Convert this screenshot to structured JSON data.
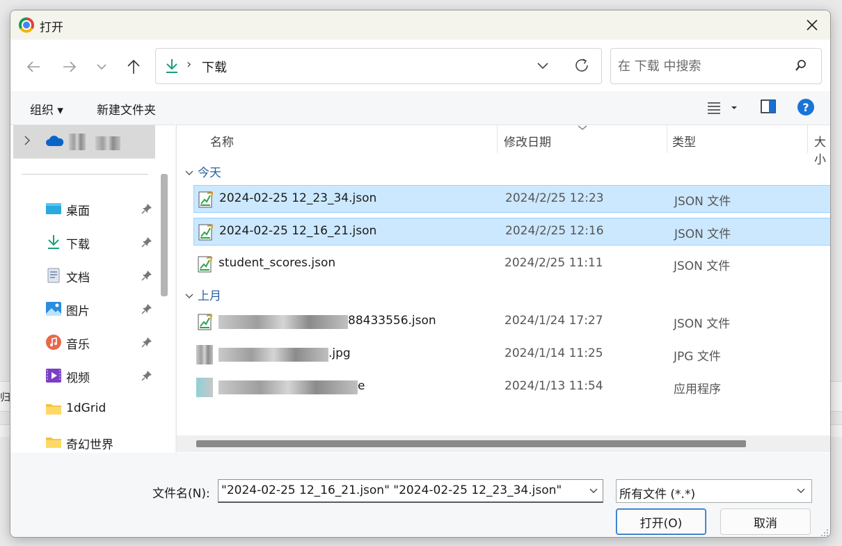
{
  "background": {
    "edge_text": "归存"
  },
  "dialog": {
    "title": "打开",
    "nav": {
      "path_separator": "›",
      "path": "下载"
    },
    "search": {
      "placeholder": "在 下载 中搜索",
      "value": ""
    },
    "toolbar": {
      "organize": "组织 ▾",
      "new_folder": "新建文件夹"
    },
    "sidebar": {
      "items": [
        {
          "label": "桌面",
          "icon": "desktop-icon",
          "pinned": true
        },
        {
          "label": "下载",
          "icon": "download-icon",
          "pinned": true
        },
        {
          "label": "文档",
          "icon": "document-icon",
          "pinned": true
        },
        {
          "label": "图片",
          "icon": "pictures-icon",
          "pinned": true
        },
        {
          "label": "音乐",
          "icon": "music-icon",
          "pinned": true
        },
        {
          "label": "视频",
          "icon": "video-icon",
          "pinned": true
        },
        {
          "label": "1dGrid",
          "icon": "folder-icon",
          "pinned": false
        },
        {
          "label": "奇幻世界",
          "icon": "folder-icon",
          "pinned": false
        }
      ]
    },
    "columns": {
      "name": "名称",
      "modified": "修改日期",
      "type": "类型",
      "size": "大小"
    },
    "groups": [
      {
        "label": "今天",
        "files": [
          {
            "name": "2024-02-25 12_23_34.json",
            "date": "2024/2/25 12:23",
            "type": "JSON 文件",
            "selected": true
          },
          {
            "name": "2024-02-25 12_16_21.json",
            "date": "2024/2/25 12:16",
            "type": "JSON 文件",
            "selected": true
          },
          {
            "name": "student_scores.json",
            "date": "2024/2/25 11:11",
            "type": "JSON 文件",
            "selected": false
          }
        ]
      },
      {
        "label": "上月",
        "files": [
          {
            "name": "88433556.json",
            "date": "2024/1/24 17:27",
            "type": "JSON 文件",
            "selected": false
          },
          {
            "name": ".jpg",
            "date": "2024/1/14 11:25",
            "type": "JPG 文件",
            "selected": false
          },
          {
            "name": "e",
            "date": "2024/1/13 11:54",
            "type": "应用程序",
            "selected": false
          }
        ]
      }
    ],
    "footer": {
      "filename_label": "文件名(N):",
      "filename_value": "\"2024-02-25 12_16_21.json\" \"2024-02-25 12_23_34.json\"",
      "filetype": "所有文件 (*.*)",
      "open_button": "打开(O)",
      "cancel_button": "取消"
    }
  }
}
